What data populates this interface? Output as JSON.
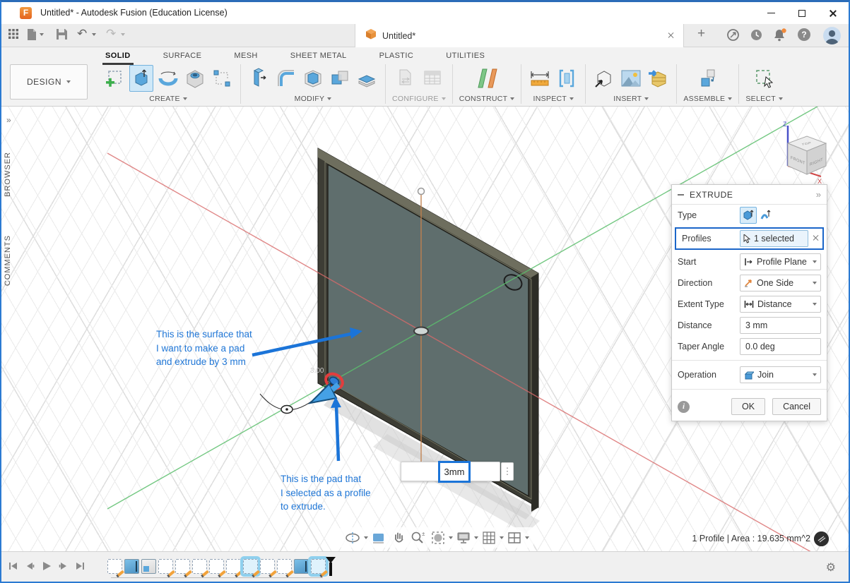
{
  "window": {
    "title": "Untitled* - Autodesk Fusion (Education License)"
  },
  "doc_tab": {
    "label": "Untitled*"
  },
  "ribbon": {
    "design_label": "DESIGN",
    "tabs": [
      "SOLID",
      "SURFACE",
      "MESH",
      "SHEET METAL",
      "PLASTIC",
      "UTILITIES"
    ],
    "active_tab": "SOLID",
    "groups": [
      "CREATE",
      "MODIFY",
      "CONFIGURE",
      "CONSTRUCT",
      "INSPECT",
      "INSERT",
      "ASSEMBLE",
      "SELECT"
    ]
  },
  "side_panels": {
    "browser": "BROWSER",
    "comments": "COMMENTS"
  },
  "viewcube": {
    "top": "TOP",
    "front": "FRONT",
    "right": "RIGHT",
    "axis_z": "Z",
    "axis_x": "X"
  },
  "annotations": {
    "surface_note": "This is the surface that\nI want to make a pad\nand extrude by 3 mm",
    "pad_note": "This is the pad that\nI selected as a profile\nto extrude.",
    "pad_dimension": "3.00"
  },
  "canvas_input": {
    "distance_value": "3mm"
  },
  "status_bar": {
    "selection_info": "1 Profile | Area : 19.635 mm^2"
  },
  "dialog": {
    "title": "EXTRUDE",
    "type_label": "Type",
    "profiles_label": "Profiles",
    "profiles_value": "1 selected",
    "start_label": "Start",
    "start_value": "Profile Plane",
    "direction_label": "Direction",
    "direction_value": "One Side",
    "extent_label": "Extent Type",
    "extent_value": "Distance",
    "distance_label": "Distance",
    "distance_value": "3 mm",
    "taper_label": "Taper Angle",
    "taper_value": "0.0 deg",
    "operation_label": "Operation",
    "operation_value": "Join",
    "ok": "OK",
    "cancel": "Cancel"
  },
  "timeline": {
    "items": [
      {
        "type": "sketch"
      },
      {
        "type": "extrude"
      },
      {
        "type": "box"
      },
      {
        "type": "sketch"
      },
      {
        "type": "sketch"
      },
      {
        "type": "sketch"
      },
      {
        "type": "sketch"
      },
      {
        "type": "sketch"
      },
      {
        "type": "sketch",
        "selected": true
      },
      {
        "type": "sketch"
      },
      {
        "type": "sketch"
      },
      {
        "type": "extrude"
      },
      {
        "type": "sketch",
        "selected": true,
        "marker": true
      }
    ]
  },
  "icons": {
    "expand_panels": "»",
    "dialog_more": "»",
    "gear": "⚙",
    "help": "?",
    "new_tab": "+",
    "undo": "↶",
    "redo": "↷",
    "kebab": "⋮",
    "fusion_logo": "F",
    "info": "i",
    "zoom_pm": "±"
  },
  "colors": {
    "accent_blue": "#1b74d8",
    "selection_fill": "#2f7fd6",
    "selection_ring": "#e23d3d",
    "panel_face": "#61706f",
    "panel_frame": "#3d3d35",
    "timeline_highlight": "#8fd0ee",
    "annotation_blue": "#1f76d6",
    "window_border": "#2b7ad2"
  }
}
